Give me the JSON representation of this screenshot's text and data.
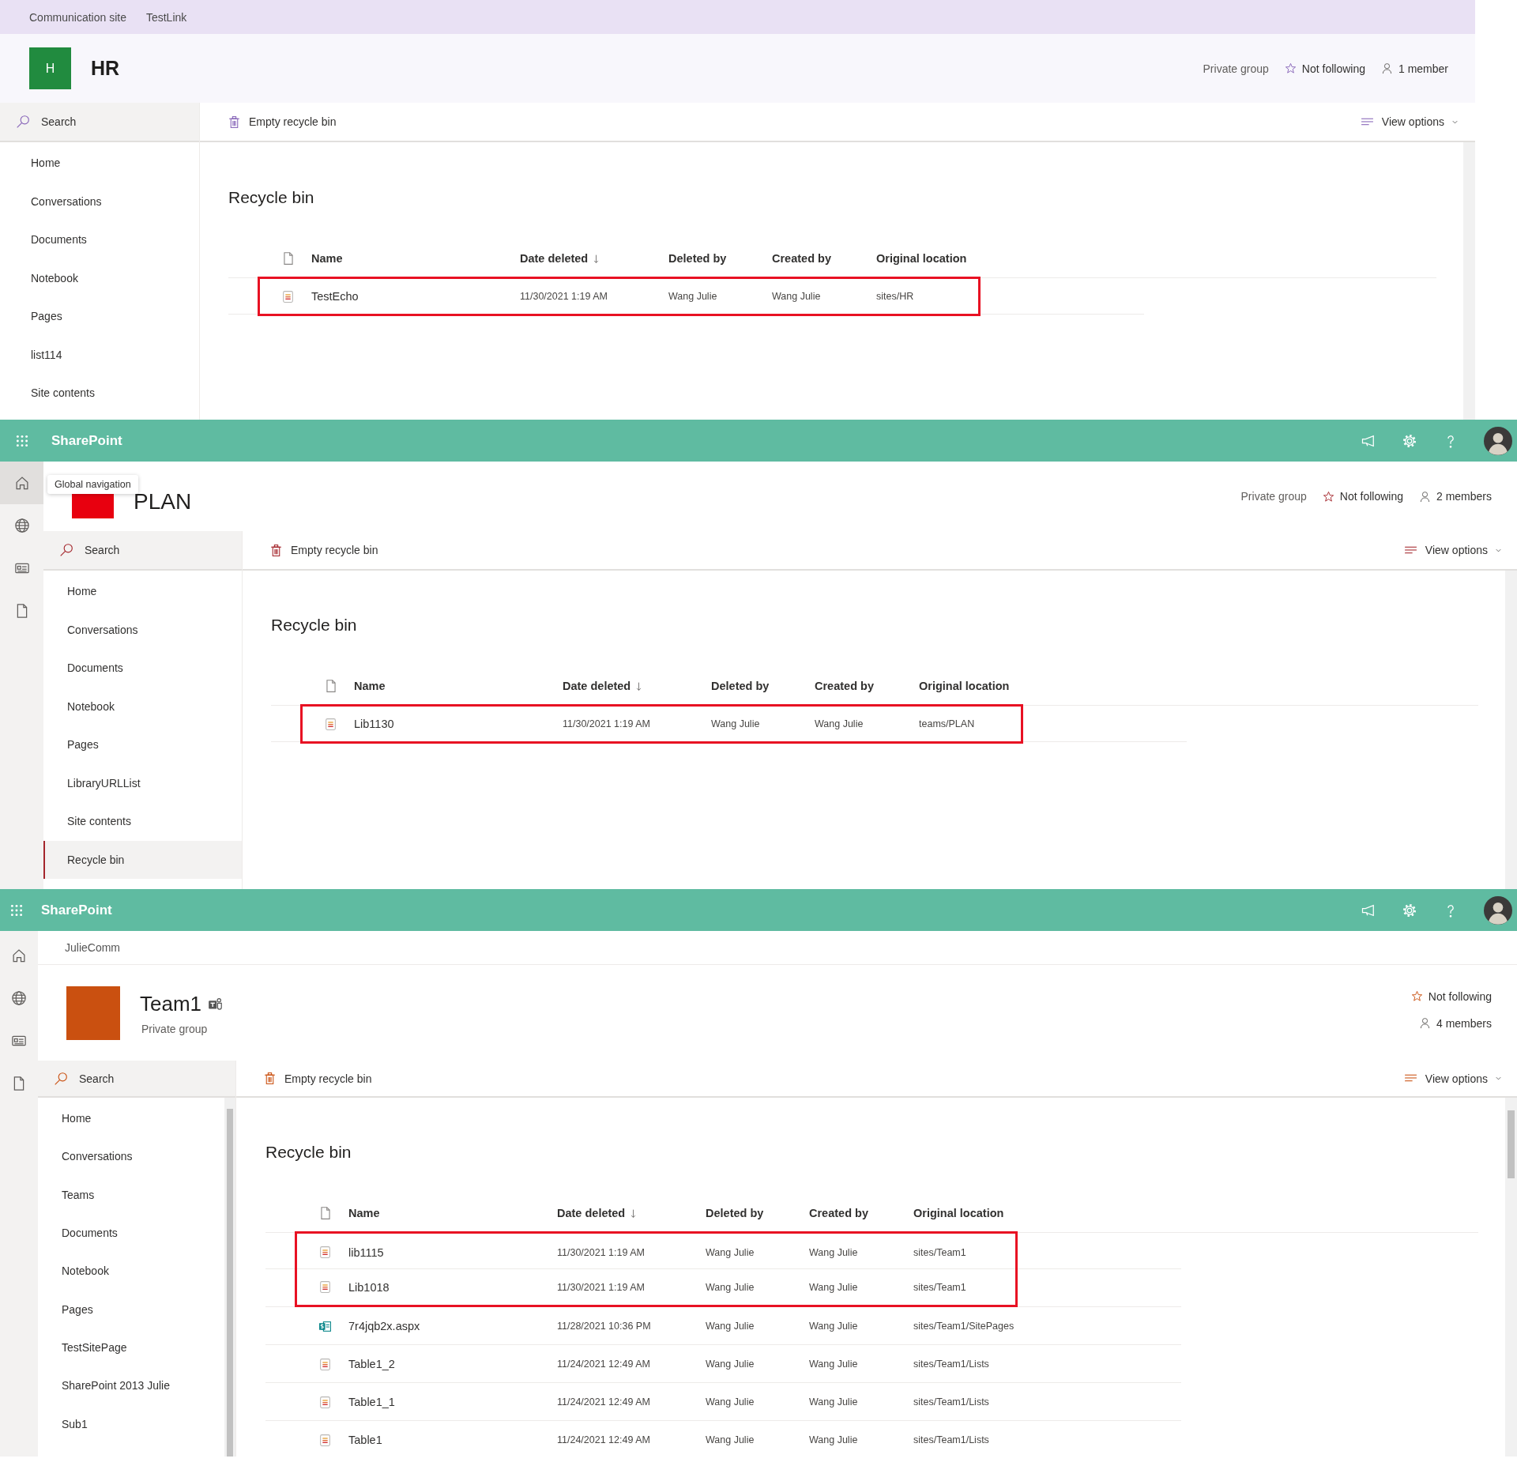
{
  "panels": [
    {
      "top_links": [
        "Communication site",
        "TestLink"
      ],
      "site": {
        "kind": "inline",
        "logo": {
          "letter": "H",
          "color": "#218b3f"
        },
        "title": "HR",
        "private_group": "Private group",
        "following": "Not following",
        "members": "1 member"
      },
      "search": {
        "placeholder": "Search"
      },
      "nav": [
        {
          "label": "Home",
          "selected": false
        },
        {
          "label": "Conversations",
          "selected": false
        },
        {
          "label": "Documents",
          "selected": false
        },
        {
          "label": "Notebook",
          "selected": false
        },
        {
          "label": "Pages",
          "selected": false
        },
        {
          "label": "list114",
          "selected": false
        },
        {
          "label": "Site contents",
          "selected": false
        }
      ],
      "commands": {
        "empty": "Empty recycle bin",
        "view_options": "View options"
      },
      "page_title": "Recycle bin",
      "columns": [
        {
          "label": "Name",
          "sorted": false
        },
        {
          "label": "Date deleted",
          "sorted": true
        },
        {
          "label": "Deleted by",
          "sorted": false
        },
        {
          "label": "Created by",
          "sorted": false
        },
        {
          "label": "Original location",
          "sorted": false
        }
      ],
      "rows": [
        {
          "kind": "list",
          "name": "TestEcho",
          "date": "11/30/2021 1:19 AM",
          "deleted_by": "Wang Julie",
          "created_by": "Wang Julie",
          "location": "sites/HR",
          "highlighted": true
        }
      ]
    },
    {
      "suite_bar": {
        "title": "SharePoint"
      },
      "app_bar": [
        {
          "selected": true
        },
        {
          "selected": false
        },
        {
          "selected": false
        },
        {
          "selected": false
        }
      ],
      "tooltip": "Global navigation",
      "site": {
        "kind": "inline",
        "logo": {
          "color": "#e8000f"
        },
        "title": "PLAN",
        "private_group": "Private group",
        "following": "Not following",
        "members": "2 members"
      },
      "search": {
        "placeholder": "Search"
      },
      "nav": [
        {
          "label": "Home",
          "selected": false
        },
        {
          "label": "Conversations",
          "selected": false
        },
        {
          "label": "Documents",
          "selected": false
        },
        {
          "label": "Notebook",
          "selected": false
        },
        {
          "label": "Pages",
          "selected": false
        },
        {
          "label": "LibraryURLList",
          "selected": false
        },
        {
          "label": "Site contents",
          "selected": false
        },
        {
          "label": "Recycle bin",
          "selected": true
        }
      ],
      "commands": {
        "empty": "Empty recycle bin",
        "view_options": "View options"
      },
      "page_title": "Recycle bin",
      "columns": [
        {
          "label": "Name",
          "sorted": false
        },
        {
          "label": "Date deleted",
          "sorted": true
        },
        {
          "label": "Deleted by",
          "sorted": false
        },
        {
          "label": "Created by",
          "sorted": false
        },
        {
          "label": "Original location",
          "sorted": false
        }
      ],
      "rows": [
        {
          "kind": "list",
          "name": "Lib1130",
          "date": "11/30/2021 1:19 AM",
          "deleted_by": "Wang Julie",
          "created_by": "Wang Julie",
          "location": "teams/PLAN",
          "highlighted": true
        }
      ]
    },
    {
      "suite_bar": {
        "title": "SharePoint"
      },
      "app_bar": [
        {
          "selected": false
        },
        {
          "selected": false
        },
        {
          "selected": false
        },
        {
          "selected": false
        }
      ],
      "breadcrumb": "JulieComm",
      "site": {
        "kind": "stacked",
        "logo": {
          "color": "#ca5010"
        },
        "title": "Team1",
        "teams": true,
        "private_group": "Private group",
        "following": "Not following",
        "members": "4 members"
      },
      "search": {
        "placeholder": "Search"
      },
      "nav": [
        {
          "label": "Home",
          "selected": false
        },
        {
          "label": "Conversations",
          "selected": false
        },
        {
          "label": "Teams",
          "selected": false
        },
        {
          "label": "Documents",
          "selected": false
        },
        {
          "label": "Notebook",
          "selected": false
        },
        {
          "label": "Pages",
          "selected": false
        },
        {
          "label": "TestSitePage",
          "selected": false
        },
        {
          "label": "SharePoint 2013 Julie",
          "selected": false
        },
        {
          "label": "Sub1",
          "selected": false
        }
      ],
      "commands": {
        "empty": "Empty recycle bin",
        "view_options": "View options"
      },
      "page_title": "Recycle bin",
      "columns": [
        {
          "label": "Name",
          "sorted": false
        },
        {
          "label": "Date deleted",
          "sorted": true
        },
        {
          "label": "Deleted by",
          "sorted": false
        },
        {
          "label": "Created by",
          "sorted": false
        },
        {
          "label": "Original location",
          "sorted": false
        }
      ],
      "rows": [
        {
          "kind": "list",
          "name": "lib1115",
          "date": "11/30/2021 1:19 AM",
          "deleted_by": "Wang Julie",
          "created_by": "Wang Julie",
          "location": "sites/Team1",
          "highlighted": true
        },
        {
          "kind": "list",
          "name": "Lib1018",
          "date": "11/30/2021 1:19 AM",
          "deleted_by": "Wang Julie",
          "created_by": "Wang Julie",
          "location": "sites/Team1",
          "highlighted": true
        },
        {
          "kind": "page",
          "name": "7r4jqb2x.aspx",
          "date": "11/28/2021 10:36 PM",
          "deleted_by": "Wang Julie",
          "created_by": "Wang Julie",
          "location": "sites/Team1/SitePages",
          "highlighted": false
        },
        {
          "kind": "list",
          "name": "Table1_2",
          "date": "11/24/2021 12:49 AM",
          "deleted_by": "Wang Julie",
          "created_by": "Wang Julie",
          "location": "sites/Team1/Lists",
          "highlighted": false
        },
        {
          "kind": "list",
          "name": "Table1_1",
          "date": "11/24/2021 12:49 AM",
          "deleted_by": "Wang Julie",
          "created_by": "Wang Julie",
          "location": "sites/Team1/Lists",
          "highlighted": false
        },
        {
          "kind": "list",
          "name": "Table1",
          "date": "11/24/2021 12:49 AM",
          "deleted_by": "Wang Julie",
          "created_by": "Wang Julie",
          "location": "sites/Team1/Lists",
          "highlighted": false
        }
      ]
    }
  ]
}
